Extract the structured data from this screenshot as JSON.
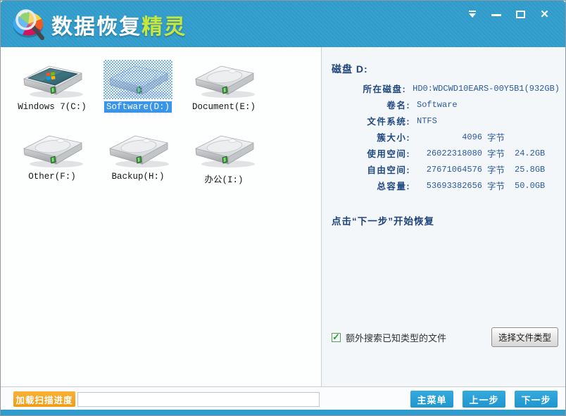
{
  "header": {
    "title_main": "数据恢复",
    "title_accent": "精灵"
  },
  "drives": [
    {
      "label": "Windows 7(C:)",
      "type": "windows",
      "selected": false
    },
    {
      "label": "Software(D:)",
      "type": "plain",
      "selected": true
    },
    {
      "label": "Document(E:)",
      "type": "plain",
      "selected": false
    },
    {
      "label": "Other(F:)",
      "type": "plain",
      "selected": false
    },
    {
      "label": "Backup(H:)",
      "type": "plain",
      "selected": false
    },
    {
      "label": "办公(I:)",
      "type": "plain",
      "selected": false
    }
  ],
  "details": {
    "title": "磁盘 D:",
    "rows": [
      {
        "label": "所在磁盘:",
        "value": "HD0:WDCWD10EARS-00Y5B1(932GB)"
      },
      {
        "label": "卷名:",
        "value": "Software"
      },
      {
        "label": "文件系统:",
        "value": "NTFS"
      },
      {
        "label": "簇大小:",
        "bytes": "4096",
        "unit": "字节",
        "gb": ""
      },
      {
        "label": "使用空间:",
        "bytes": "26022318080",
        "unit": "字节",
        "gb": "24.2GB"
      },
      {
        "label": "自由空间:",
        "bytes": "27671064576",
        "unit": "字节",
        "gb": "25.8GB"
      },
      {
        "label": "总容量:",
        "bytes": "53693382656",
        "unit": "字节",
        "gb": "50.0GB"
      }
    ],
    "hint": "点击“下一步”开始恢复"
  },
  "options": {
    "checkbox_label": "额外搜索已知类型的文件",
    "checkbox_checked": true,
    "select_type_button": "选择文件类型"
  },
  "footer": {
    "load_progress_button": "加载扫描进度",
    "progress_value": "",
    "main_menu_button": "主菜单",
    "prev_button": "上一步",
    "next_button": "下一步"
  },
  "colors": {
    "header_blue": "#2e9bca",
    "title_accent_green": "#c6e83e",
    "selection_blue": "#3a95e8",
    "nav_button_blue": "#2aa2da",
    "load_button_orange": "#f5a623",
    "detail_text_navy": "#21497f",
    "checkbox_green": "#18a52e"
  }
}
